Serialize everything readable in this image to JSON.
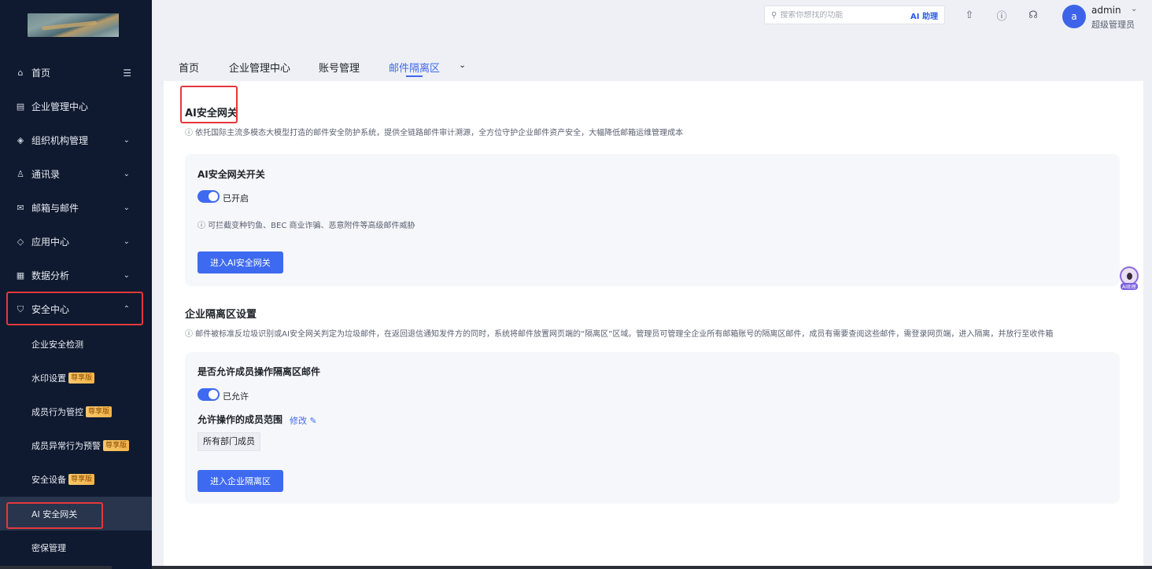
{
  "sidebar": {
    "items": [
      {
        "label": "首页",
        "icon": "home-icon"
      },
      {
        "label": "企业管理中心",
        "icon": "building-icon"
      },
      {
        "label": "组织机构管理",
        "icon": "org-icon"
      },
      {
        "label": "通讯录",
        "icon": "contacts-icon"
      },
      {
        "label": "邮箱与邮件",
        "icon": "mail-icon"
      },
      {
        "label": "应用中心",
        "icon": "apps-icon"
      },
      {
        "label": "数据分析",
        "icon": "chart-icon"
      },
      {
        "label": "安全中心",
        "icon": "shield-icon"
      }
    ],
    "sub_items": [
      {
        "label": "企业安全检测",
        "tag": ""
      },
      {
        "label": "水印设置",
        "tag": "尊享版"
      },
      {
        "label": "成员行为管控",
        "tag": "尊享版"
      },
      {
        "label": "成员异常行为预警",
        "tag": "尊享版"
      },
      {
        "label": "安全设备",
        "tag": "尊享版"
      },
      {
        "label": "AI 安全网关",
        "tag": ""
      },
      {
        "label": "密保管理",
        "tag": ""
      }
    ]
  },
  "topbar": {
    "search_placeholder": "搜索你想找的功能",
    "ai_label": "AI 助理",
    "user_initial": "a",
    "user_name": "admin",
    "user_role": "超级管理员"
  },
  "tabs": [
    {
      "label": "首页"
    },
    {
      "label": "企业管理中心"
    },
    {
      "label": "账号管理"
    },
    {
      "label": "邮件隔离区"
    }
  ],
  "active_tab": "邮件隔离区",
  "gateway": {
    "title": "AI安全网关",
    "desc": "ⓘ 依托国际主流多模态大模型打造的邮件安全防护系统，提供全链路邮件审计溯源，全方位守护企业邮件资产安全，大幅降低邮箱运维管理成本",
    "card_title": "AI安全网关开关",
    "toggle_label": "已开启",
    "hint": "ⓘ 可拦截变种钓鱼、BEC 商业诈骗、恶意附件等高级邮件威胁",
    "button": "进入AI安全网关"
  },
  "quarantine": {
    "title": "企业隔离区设置",
    "desc": "ⓘ 邮件被标准反垃圾识别或AI安全网关判定为垃圾邮件，在返回退信通知发件方的同时，系统将邮件放置网页端的“隔离区”区域。管理员可管理全企业所有邮箱账号的隔离区邮件，成员有需要查阅这些邮件，需登录网页端，进入隔离，并放行至收件箱",
    "card_title": "是否允许成员操作隔离区邮件",
    "toggle_label": "已允许",
    "scope_label": "允许操作的成员范围",
    "edit_link": "修改",
    "scope_value": "所有部门成员",
    "button": "进入企业隔离区"
  },
  "assistant_label": "AI助理",
  "colors": {
    "accent": "#3d6af0",
    "sidebar_bg": "#0f1a30",
    "highlight": "#e5383b",
    "tag": "#f3b34a"
  }
}
